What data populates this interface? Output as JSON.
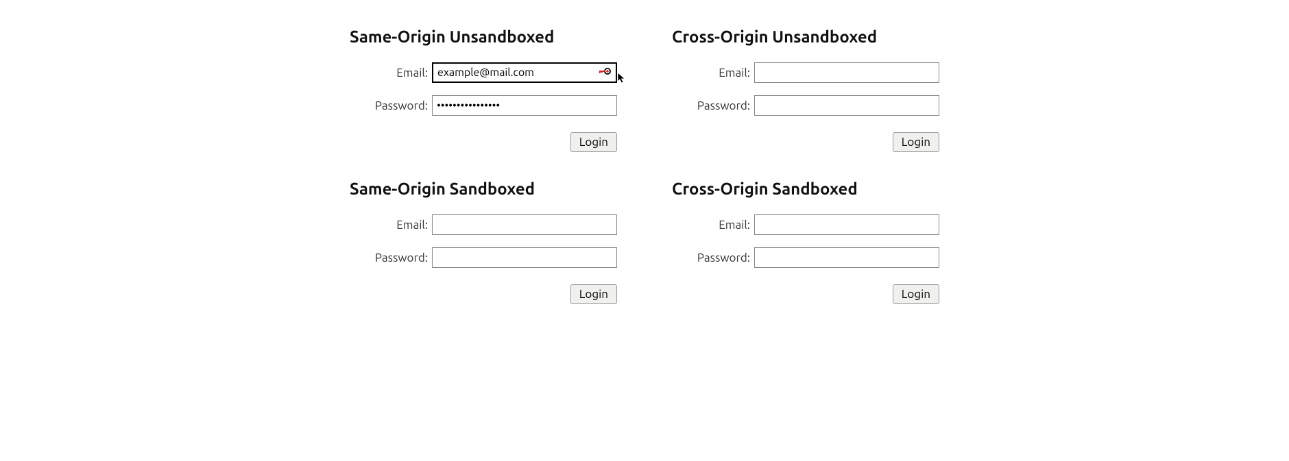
{
  "forms": [
    {
      "heading": "Same-Origin Unsandboxed",
      "email_label": "Email:",
      "password_label": "Password:",
      "email_value": "example@mail.com",
      "password_value": "••••••••••••••••",
      "login_label": "Login",
      "active": true,
      "show_key_icon": true
    },
    {
      "heading": "Cross-Origin Unsandboxed",
      "email_label": "Email:",
      "password_label": "Password:",
      "email_value": "",
      "password_value": "",
      "login_label": "Login",
      "active": false,
      "show_key_icon": false
    },
    {
      "heading": "Same-Origin Sandboxed",
      "email_label": "Email:",
      "password_label": "Password:",
      "email_value": "",
      "password_value": "",
      "login_label": "Login",
      "active": false,
      "show_key_icon": false
    },
    {
      "heading": "Cross-Origin Sandboxed",
      "email_label": "Email:",
      "password_label": "Password:",
      "email_value": "",
      "password_value": "",
      "login_label": "Login",
      "active": false,
      "show_key_icon": false
    }
  ]
}
